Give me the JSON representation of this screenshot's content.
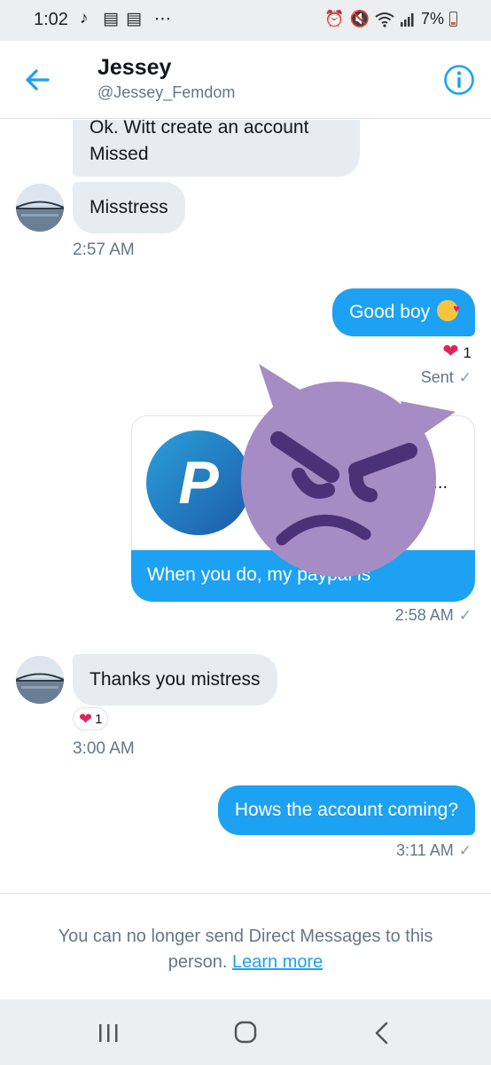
{
  "status_bar": {
    "time": "1:02",
    "battery": "7%"
  },
  "header": {
    "name": "Jessey",
    "handle": "@Jessey_Femdom"
  },
  "messages": {
    "m1_line1": "Ok. Witt create an account",
    "m1_line2": "Missed",
    "m2": "Misstress",
    "t1": "2:57 AM",
    "m3": "Good boy",
    "m3_reaction_count": "1",
    "m3_status": "Sent",
    "card_more": "...",
    "card_caption": "When you do, my paypal is",
    "t2": "2:58 AM",
    "m4": "Thanks you mistress",
    "m4_reaction_count": "1",
    "t3": "3:00 AM",
    "m5": "Hows the account coming?",
    "t4": "3:11 AM"
  },
  "footer": {
    "text": "You can no longer send Direct Messages to this person.",
    "link": "Learn more"
  },
  "colors": {
    "accent": "#1da1f2",
    "incoming_bubble": "#e6ecf0",
    "overlay_emoji": "#a68cc4"
  },
  "icons": {
    "back": "arrow-left-icon",
    "info": "info-icon",
    "overlay": "angry-devil-emoji"
  }
}
